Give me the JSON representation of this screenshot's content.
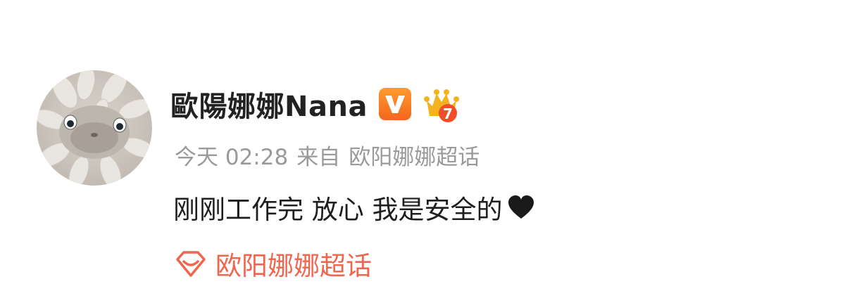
{
  "post": {
    "author": {
      "name": "歐陽娜娜Nana",
      "verified_icon": "verified-v-icon",
      "level_icon": "crown-level-icon",
      "level": "7",
      "avatar_icon": "cat-avatar"
    },
    "meta": {
      "time": "今天 02:28",
      "source_prefix": "来自",
      "source": "欧阳娜娜超话"
    },
    "content": {
      "text": "刚刚工作完 放心 我是安全的",
      "trailing_icon": "black-heart-icon"
    },
    "topic": {
      "icon": "supertopic-diamond-icon",
      "label": "欧阳娜娜超话"
    }
  },
  "colors": {
    "username": "#222222",
    "meta": "#9a9a9a",
    "content": "#1e1e1e",
    "topic": "#f0654e",
    "verified_badge": "#f3661d",
    "level_badge": "#f5b21f"
  }
}
